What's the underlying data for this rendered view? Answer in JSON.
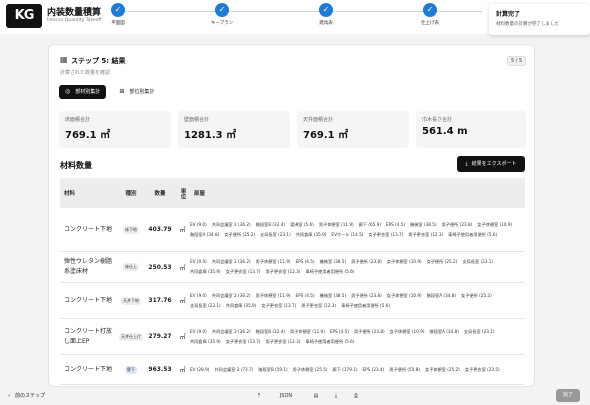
{
  "header": {
    "logo_text": "KG",
    "app_title": "内装数量積算",
    "app_subtitle": "Interior Quantity Takeoff"
  },
  "stepper": {
    "steps": [
      {
        "label": "平面図",
        "check": "✓"
      },
      {
        "label": "キープラン",
        "check": "✓"
      },
      {
        "label": "建具表",
        "check": "✓"
      },
      {
        "label": "仕上げ表",
        "check": "✓"
      }
    ]
  },
  "toast": {
    "title": "計算完了",
    "message": "材料数量の計算が完了しました"
  },
  "card": {
    "title": "ステップ 5: 結果",
    "description": "計算された数量を確認",
    "counter": "5 / 5",
    "tabs": [
      {
        "label": "部材別集計",
        "active": true
      },
      {
        "label": "部位別集計",
        "active": false
      }
    ],
    "stats": [
      {
        "label": "床面積合計",
        "value": "769.1 ㎡"
      },
      {
        "label": "壁面積合計",
        "value": "1281.3 ㎡"
      },
      {
        "label": "天井面積合計",
        "value": "769.1 ㎡"
      },
      {
        "label": "巾木長さ合計",
        "value": "561.4 m"
      }
    ],
    "materials_title": "材料数量",
    "export_label": "結果をエクスポート"
  },
  "table": {
    "headers": [
      "材料",
      "種別",
      "数量",
      "単位",
      "部屋"
    ],
    "rows": [
      {
        "material": "コンクリート下地",
        "type": "床下地",
        "qty": "403.79",
        "unit": "㎡",
        "rooms": [
          "EV (9.0)",
          "共同会議室 2 (36.2)",
          "階段室B (32.4)",
          "湯沸室 (5.6)",
          "男子休憩室 (11.9)",
          "廊下 (65.9)",
          "EPS (4.5)",
          "機械室 (38.5)",
          "男子便所 (23.8)",
          "女子休憩室 (10.9)",
          "階段室A (34.8)",
          "女子便所 (25.2)",
          "支局長室 (23.1)",
          "共同倉庫 (35.9)",
          "EVホール (14.5)",
          "女子更衣室 (13.7)",
          "男子更衣室 (12.3)",
          "車椅子使用者用便所 (5.6)"
        ]
      },
      {
        "material": "弾性ウレタン樹脂系塗床材",
        "type": "床仕上",
        "qty": "250.53",
        "unit": "㎡",
        "rooms": [
          "EV (9.0)",
          "共同会議室 2 (36.2)",
          "男子休憩室 (11.9)",
          "EPS (4.5)",
          "機械室 (38.5)",
          "男子便所 (23.8)",
          "女子休憩室 (10.9)",
          "女子便所 (25.2)",
          "支局長室 (23.1)",
          "共同倉庫 (35.9)",
          "女子更衣室 (13.7)",
          "男子更衣室 (12.3)",
          "車椅子使用者用便所 (5.6)"
        ]
      },
      {
        "material": "コンクリート下地",
        "type": "天井下地",
        "qty": "317.76",
        "unit": "㎡",
        "rooms": [
          "EV (9.0)",
          "共同会議室 2 (36.2)",
          "男子休憩室 (11.9)",
          "EPS (4.5)",
          "機械室 (38.5)",
          "男子便所 (23.8)",
          "女子休憩室 (10.9)",
          "階段室A (34.8)",
          "女子便所 (25.2)",
          "支局長室 (23.1)",
          "共同倉庫 (35.9)",
          "女子更衣室 (13.7)",
          "男子更衣室 (12.3)",
          "車椅子使用者用便所 (5.6)"
        ]
      },
      {
        "material": "コンクリート打放し面上EP",
        "type": "天井仕上げ",
        "qty": "279.27",
        "unit": "㎡",
        "rooms": [
          "EV (9.0)",
          "共同会議室 2 (36.2)",
          "階段室B (32.4)",
          "男子休憩室 (11.9)",
          "EPS (4.5)",
          "男子便所 (23.8)",
          "女子休憩室 (10.9)",
          "階段室A (34.8)",
          "支局長室 (23.1)",
          "共同倉庫 (35.9)",
          "女子更衣室 (13.7)",
          "男子更衣室 (12.3)",
          "車椅子使用者用便所 (5.6)"
        ]
      },
      {
        "material": "コンクリート下地",
        "type": "壁下",
        "qty": "963.53",
        "unit": "㎡",
        "rooms": [
          "EV (28.9)",
          "共同会議室 2 (73.7)",
          "階段室B (59.1)",
          "男子休憩室 (25.5)",
          "廊下 (179.1)",
          "EPS (23.4)",
          "男子便所 (55.8)",
          "女子休憩室 (25.2)",
          "女子更衣室 (23.5)"
        ]
      }
    ]
  },
  "bottom": {
    "prev_label": "前のステップ",
    "tools": [
      "⤒",
      "JSON",
      "▤",
      "⤓",
      "⎙"
    ],
    "done_label": "完了"
  },
  "colors": {
    "accent": "#1e7cd6",
    "dark": "#111111"
  }
}
